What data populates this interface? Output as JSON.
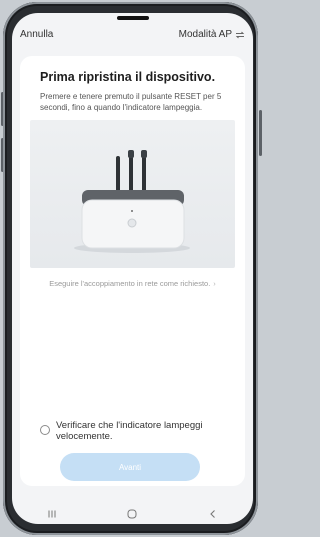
{
  "top_bar": {
    "cancel_label": "Annulla",
    "mode_label": "Modalità AP"
  },
  "card": {
    "title": "Prima ripristina il dispositivo.",
    "description": "Premere e tenere premuto il pulsante RESET per 5 secondi, fino a quando l'indicatore lampeggia.",
    "help_link": "Eseguire l'accoppiamento in rete come richiesto.",
    "confirm_label": "Verificare che l'indicatore lampeggi velocemente.",
    "confirm_checked": false,
    "next_button_label": "Avanti",
    "next_enabled": false
  },
  "nav_bar": {
    "items": [
      "recents-icon",
      "home-icon",
      "back-icon"
    ]
  },
  "colors": {
    "accent_disabled": "#c5dff5",
    "card_bg": "#ffffff",
    "screen_bg": "#f3f4f6",
    "device_top": "#5f6368"
  }
}
